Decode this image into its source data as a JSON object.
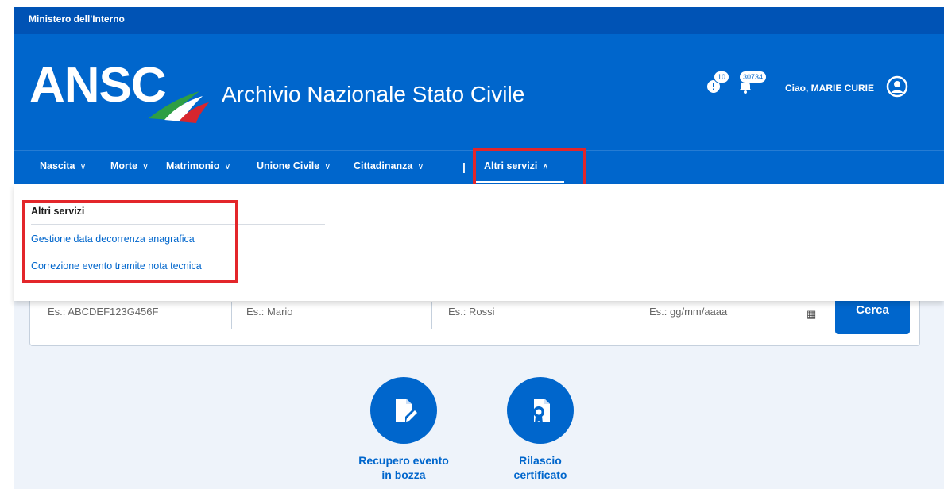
{
  "top_bar": {
    "org": "Ministero dell'Interno"
  },
  "header": {
    "logo_text": "ANSC",
    "title": "Archivio Nazionale Stato Civile",
    "alerts_count": "10",
    "notifications_count": "30734",
    "greeting": "Ciao,  MARIE CURIE"
  },
  "nav": {
    "items": [
      {
        "label": "Nascita"
      },
      {
        "label": "Morte"
      },
      {
        "label": "Matrimonio"
      },
      {
        "label": "Unione Civile"
      },
      {
        "label": "Cittadinanza"
      },
      {
        "label": "Altri servizi"
      }
    ],
    "separator": "|"
  },
  "dropdown": {
    "title": "Altri servizi",
    "links": [
      {
        "label": "Gestione data decorrenza anagrafica"
      },
      {
        "label": "Correzione evento tramite nota tecnica"
      }
    ]
  },
  "search": {
    "fields": [
      {
        "placeholder": "Es.: ABCDEF123G456F"
      },
      {
        "placeholder": "Es.: Mario"
      },
      {
        "placeholder": "Es.: Rossi"
      },
      {
        "placeholder": "Es.: gg/mm/aaaa"
      }
    ],
    "button": "Cerca"
  },
  "services": [
    {
      "label_line1": "Recupero evento",
      "label_line2": "in bozza",
      "icon": "document-edit-icon"
    },
    {
      "label_line1": "Rilascio",
      "label_line2": "certificato",
      "icon": "certificate-icon"
    }
  ],
  "colors": {
    "primary": "#0066cc",
    "topbar": "#0053b5",
    "highlight": "#e3262a",
    "page_bg": "#eef3fa"
  }
}
